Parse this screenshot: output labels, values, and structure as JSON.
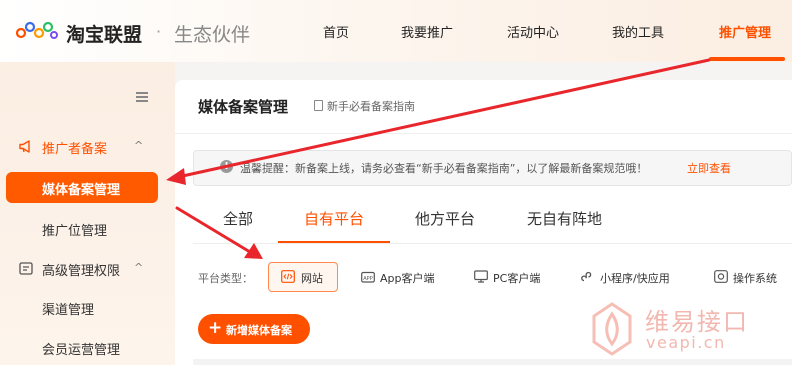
{
  "header": {
    "brand": "淘宝联盟",
    "separator": "·",
    "subtitle": "生态伙伴",
    "nav": [
      "首页",
      "我要推广",
      "活动中心",
      "我的工具",
      "推广管理"
    ],
    "active_nav": "推广管理"
  },
  "sidebar": {
    "groups": [
      {
        "label": "推广者备案",
        "chevron": "^",
        "items": [
          "媒体备案管理",
          "推广位管理"
        ]
      },
      {
        "label": "高级管理权限",
        "chevron": "^",
        "items": [
          "渠道管理",
          "会员运营管理"
        ]
      }
    ],
    "active_item": "媒体备案管理"
  },
  "main": {
    "title": "媒体备案管理",
    "guide_link": "新手必看备案指南",
    "notice": {
      "icon": "!",
      "text": "温馨提醒：新备案上线，请务必查看“新手必看备案指南”，以了解最新备案规范哦！",
      "link": "立即查看"
    },
    "tabs": [
      "全部",
      "自有平台",
      "他方平台",
      "无自有阵地"
    ],
    "active_tab": "自有平台",
    "platform_type": {
      "label": "平台类型：",
      "options": [
        "网站",
        "App客户端",
        "PC客户端",
        "小程序/快应用",
        "操作系统"
      ],
      "selected": "网站"
    },
    "add_button": {
      "icon": "+",
      "label": "新增媒体备案"
    }
  },
  "watermark": {
    "text": "维易接口",
    "url": "veapi.cn"
  },
  "colors": {
    "accent": "#ff5000",
    "sidebar_active": "#ff5a00",
    "arrow": "#e8262c"
  }
}
